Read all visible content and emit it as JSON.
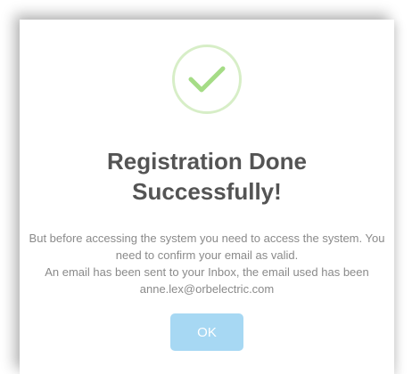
{
  "dialog": {
    "icon": "success-check-icon",
    "title": "Registration Done Successfully!",
    "message_line1": "But before accessing the system you need to access the system. You need to confirm your email as valid.",
    "message_line2": "An email has been sent to your Inbox, the email used has been anne.lex@orbelectric.com",
    "ok_label": "OK"
  },
  "colors": {
    "check_stroke": "#a5dc86",
    "check_ring": "#d7eec7",
    "button_bg": "#a7d8f3",
    "title": "#545454",
    "message": "#8a8a8a"
  }
}
